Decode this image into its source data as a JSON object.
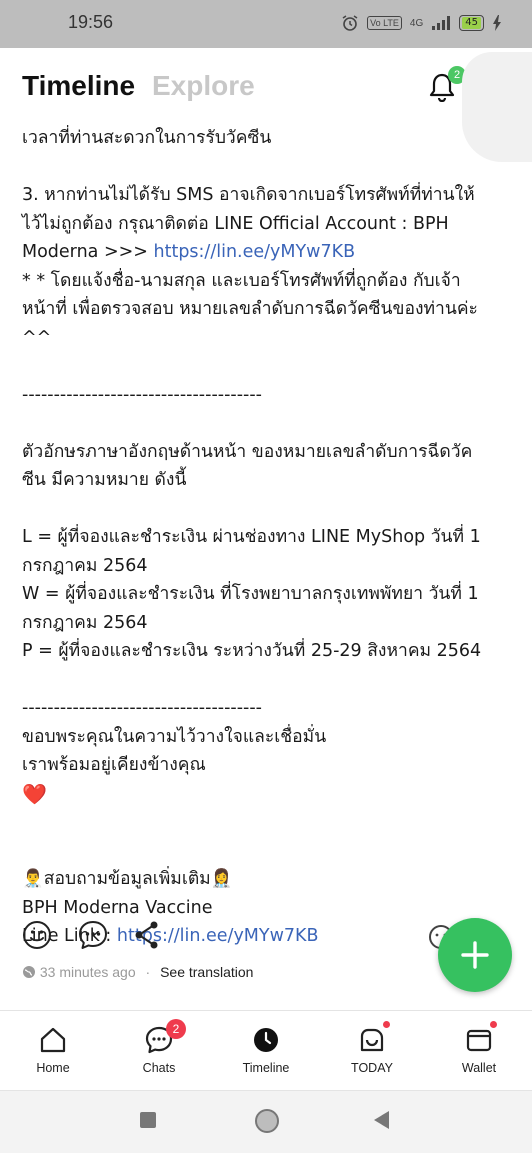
{
  "status_bar": {
    "time": "19:56",
    "alarm_icon": "alarm-icon",
    "volte_label": "Vo LTE",
    "network_label": "4G",
    "battery_level": "45",
    "charging_icon": "lightning-icon"
  },
  "header": {
    "tab_active": "Timeline",
    "tab_inactive": "Explore",
    "notification_badge": "2"
  },
  "post": {
    "lines": [
      "เวลาที่ท่านสะดวกในการรับวัคซีน",
      "",
      "3. หากท่านไม่ได้รับ SMS อาจเกิดจากเบอร์โทรศัพท์ที่ท่านให้",
      "ไว้ไม่ถูกต้อง กรุณาติดต่อ LINE Official Account : BPH",
      "Moderna >>> ",
      "* * โดยแจ้งชื่อ-นามสกุล และเบอร์โทรศัพท์ที่ถูกต้อง กับเจ้า",
      "หน้าที่ เพื่อตรวจสอบ หมายเลขลำดับการฉีดวัคซีนของท่านค่ะ",
      "^^",
      "",
      "--------------------------------------",
      "",
      "ตัวอักษรภาษาอังกฤษด้านหน้า ของหมายเลขลำดับการฉีดวัค",
      "ซีน มีความหมาย ดังนี้",
      "",
      "L = ผู้ที่จองและชำระเงิน ผ่านช่องทาง LINE MyShop วันที่ 1",
      "กรกฎาคม 2564",
      "W = ผู้ที่จองและชำระเงิน ที่โรงพยาบาลกรุงเทพพัทยา วันที่ 1",
      "กรกฎาคม 2564",
      "P = ผู้ที่จองและชำระเงิน ระหว่างวันที่ 25-29 สิงหาคม 2564",
      "",
      "--------------------------------------",
      "ขอบพระคุณในความไว้วางใจและเชื่อมั่น",
      "เราพร้อมอยู่เคียงข้างคุณ",
      "❤️",
      "",
      "",
      "👨‍⚕️สอบถามข้อมูลเพิ่มเติม👩‍⚕️",
      "BPH Moderna Vaccine",
      "Line Link : "
    ],
    "link_1": "https://lin.ee/yMYw7KB",
    "link_2": "https://lin.ee/yMYw7KB",
    "time_ago": "33 minutes ago",
    "separator": "·",
    "see_translation": "See translation"
  },
  "bottom_nav": {
    "items": [
      {
        "label": "Home",
        "icon": "home-icon"
      },
      {
        "label": "Chats",
        "icon": "chat-icon",
        "badge": "2"
      },
      {
        "label": "Timeline",
        "icon": "timeline-clock-icon"
      },
      {
        "label": "TODAY",
        "icon": "today-icon"
      },
      {
        "label": "Wallet",
        "icon": "wallet-icon"
      }
    ]
  },
  "colors": {
    "accent_green": "#36c160",
    "link_blue": "#3a64b8",
    "badge_red": "#ef3b4d"
  }
}
